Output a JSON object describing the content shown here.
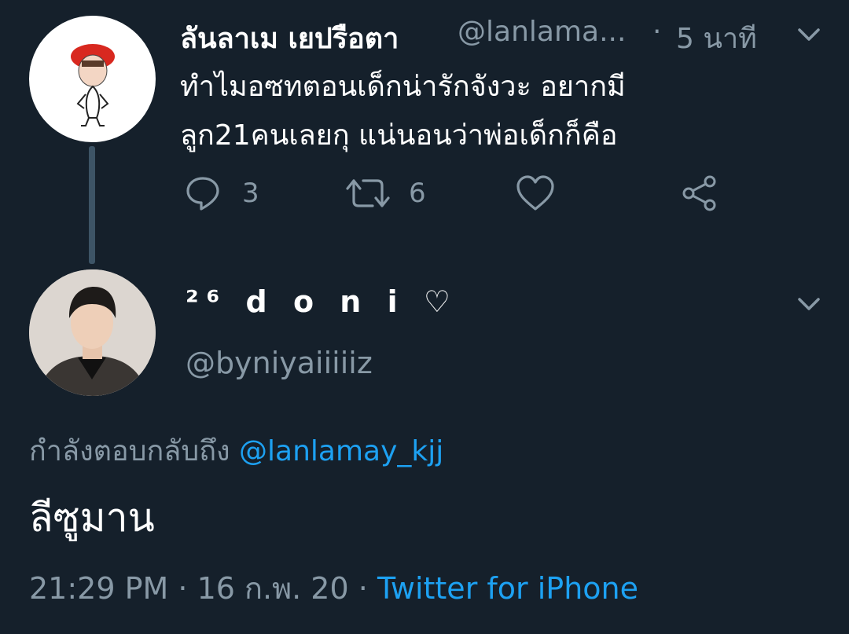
{
  "parent_tweet": {
    "author_name": "ลันลาเม เยปรือตา",
    "handle": "@lanlama...",
    "separator": "·",
    "time_ago": "5 นาที",
    "text_line1": "ทำไมอซทตอนเด็กน่ารักจังวะ อยากมี",
    "text_line2": "ลูก21คนเลยกุ แน่นอนว่าพ่อเด็กก็คือ",
    "reply_count": "3",
    "retweet_count": "6"
  },
  "reply_tweet": {
    "author_name": "²⁶ d o n i ♡",
    "handle": "@byniyaiiiiiz",
    "replying_label": "กำลังตอบกลับถึง",
    "replying_to": "@lanlamay_kjj",
    "text": "ลีซูมาน",
    "time": "21:29 PM",
    "date": "16 ก.พ. 20",
    "separator": "·",
    "client": "Twitter for iPhone"
  },
  "icons": [
    "reply-icon",
    "retweet-icon",
    "like-icon",
    "share-icon",
    "chevron-down-icon"
  ],
  "colors": {
    "background": "#15202b",
    "text": "#ffffff",
    "secondary": "#8899a6",
    "accent": "#1da1f2",
    "thread_line": "#3d5466"
  }
}
